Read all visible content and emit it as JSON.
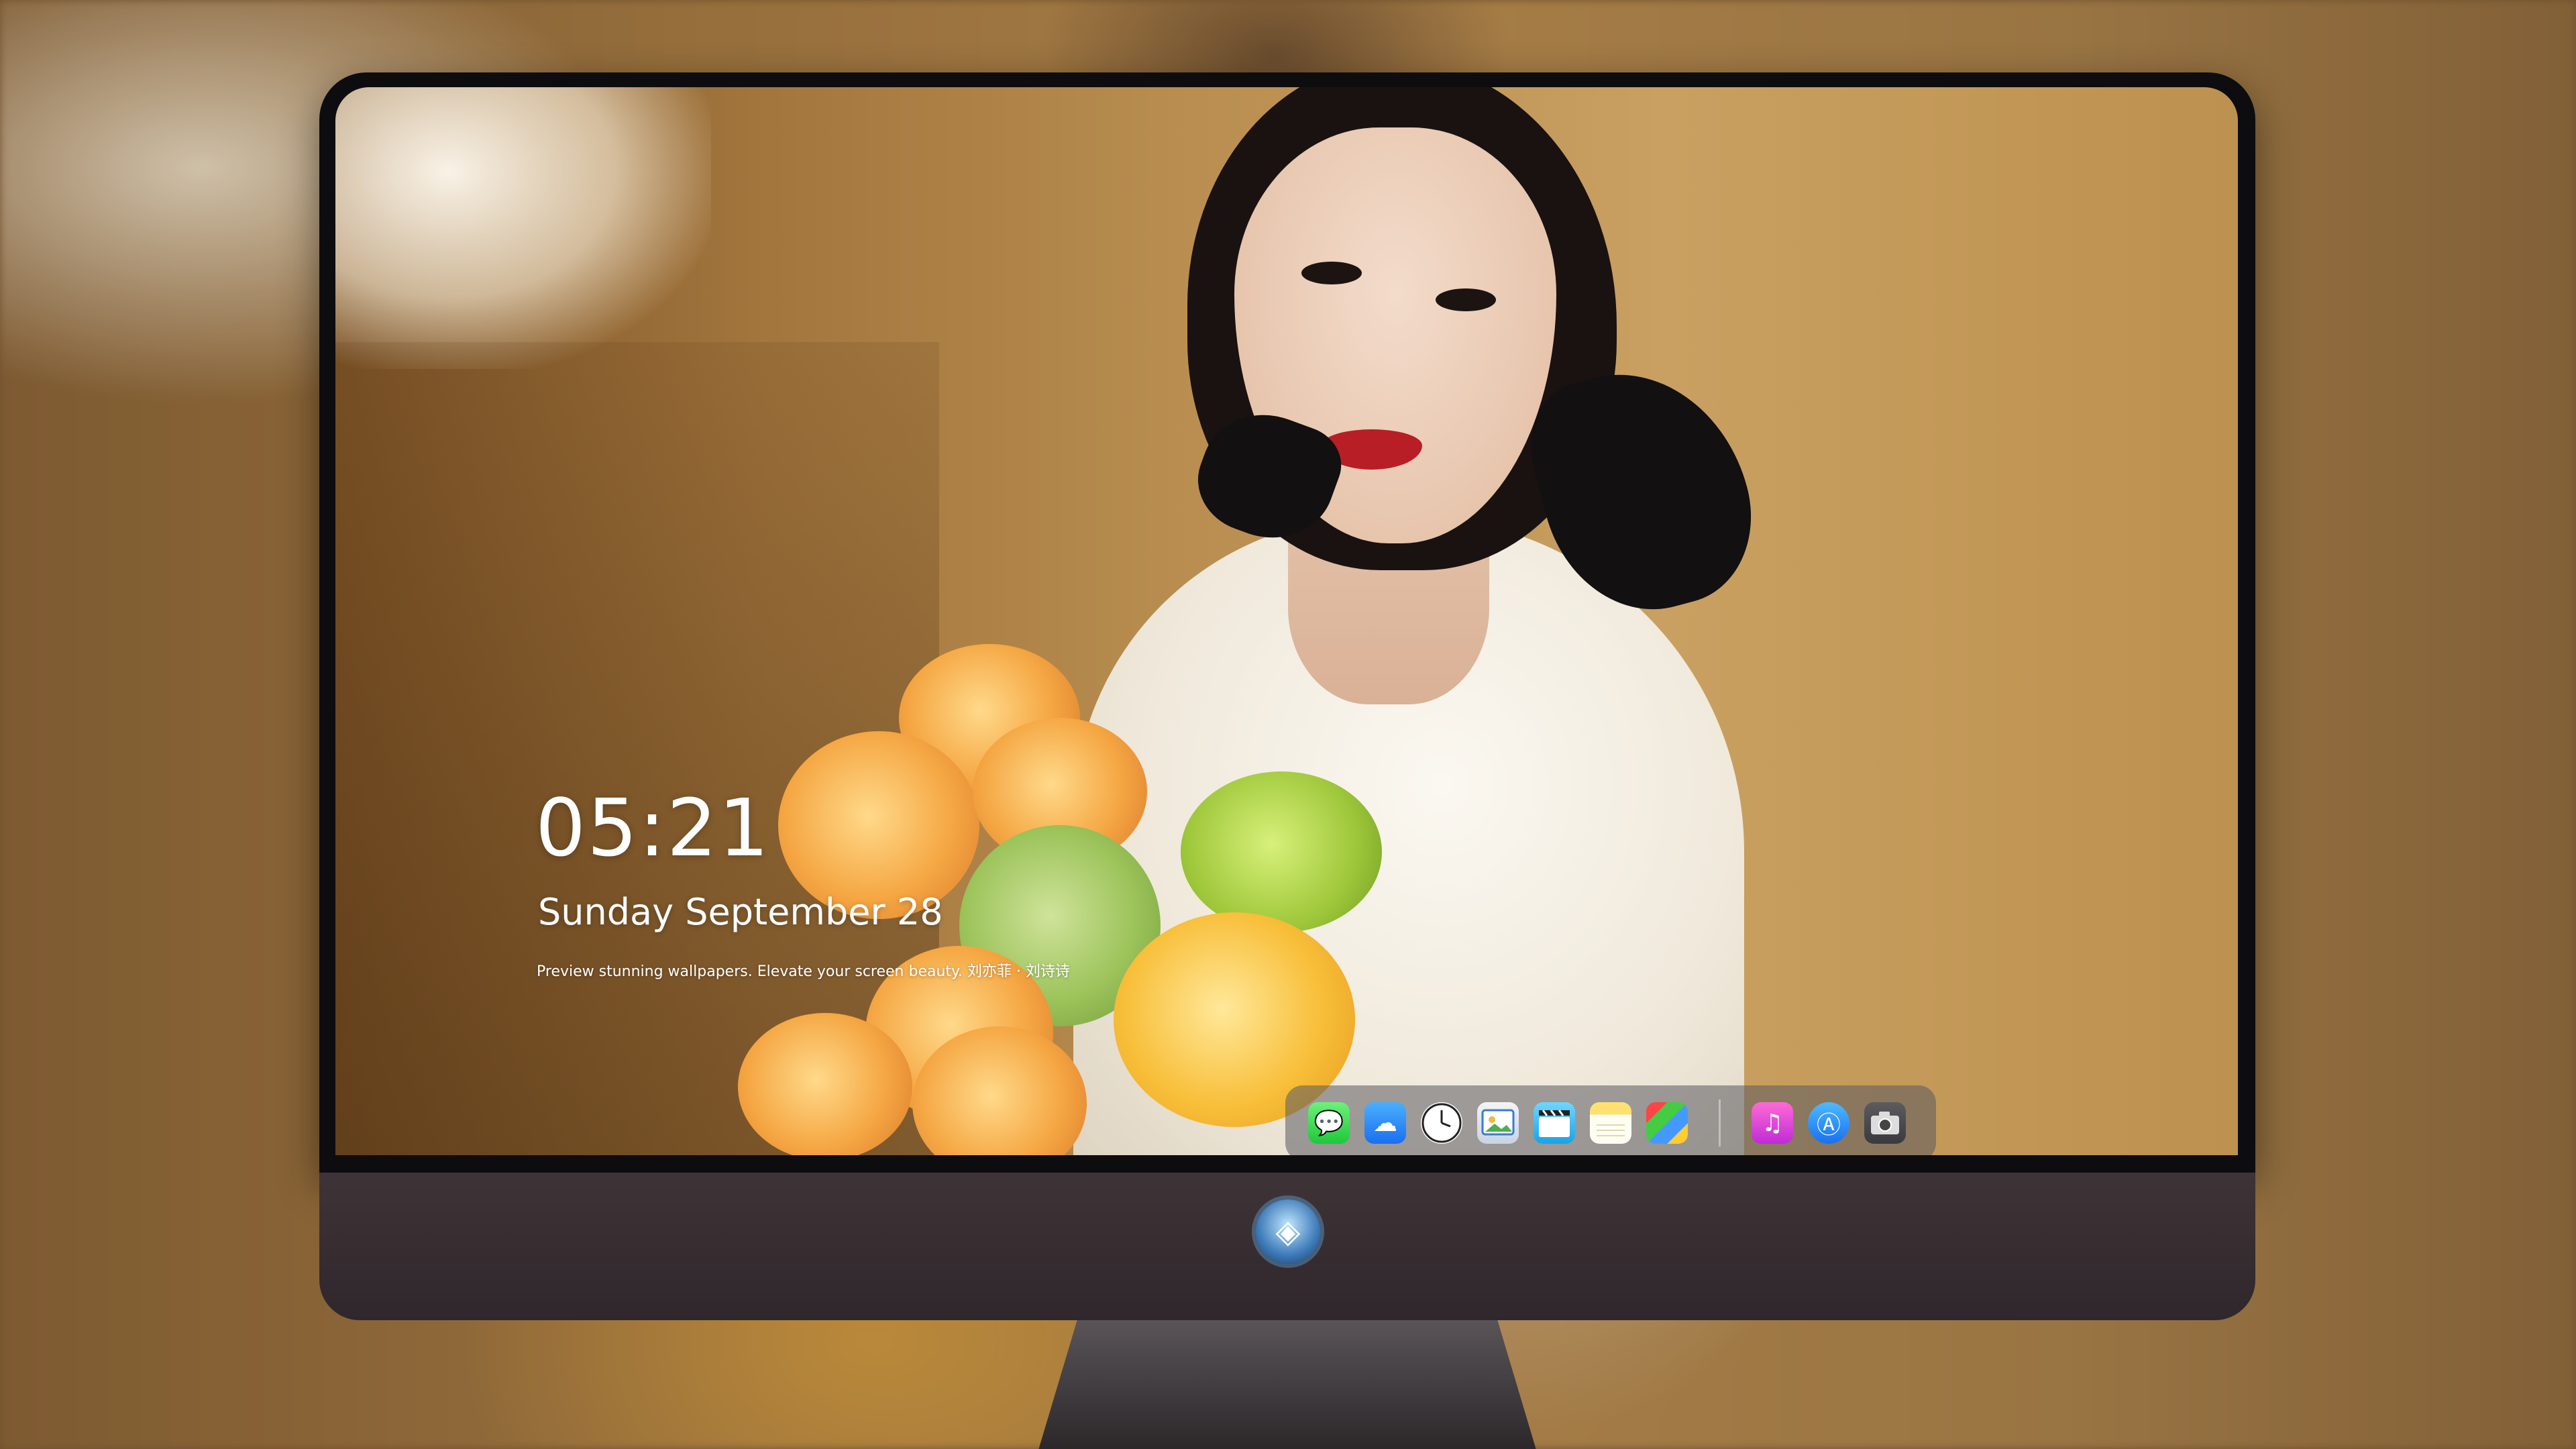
{
  "lockscreen": {
    "time": "05:21",
    "date": "Sunday September  28",
    "tagline": "Preview stunning wallpapers. Elevate your screen beauty. 刘亦菲 · 刘诗诗"
  },
  "dock": {
    "apps": [
      {
        "name": "Messages",
        "icon": "messages-icon",
        "glyph": "💬"
      },
      {
        "name": "Weather",
        "icon": "weather-icon",
        "glyph": "☁"
      },
      {
        "name": "Clock",
        "icon": "clock-icon",
        "glyph": "🕐"
      },
      {
        "name": "Preview",
        "icon": "preview-icon",
        "glyph": "🖼"
      },
      {
        "name": "Clips",
        "icon": "clapperboard-icon",
        "glyph": "🎬"
      },
      {
        "name": "Notes",
        "icon": "notes-icon",
        "glyph": ""
      },
      {
        "name": "Photo Booth",
        "icon": "photo-booth-icon",
        "glyph": ""
      },
      {
        "name": "Music",
        "icon": "music-icon",
        "glyph": "♫"
      },
      {
        "name": "App Store",
        "icon": "app-store-icon",
        "glyph": "Ⓐ"
      },
      {
        "name": "Camera",
        "icon": "camera-icon",
        "glyph": "📷"
      }
    ]
  },
  "chin": {
    "logo_icon": "mascot-logo-icon",
    "logo_glyph": "◈"
  }
}
